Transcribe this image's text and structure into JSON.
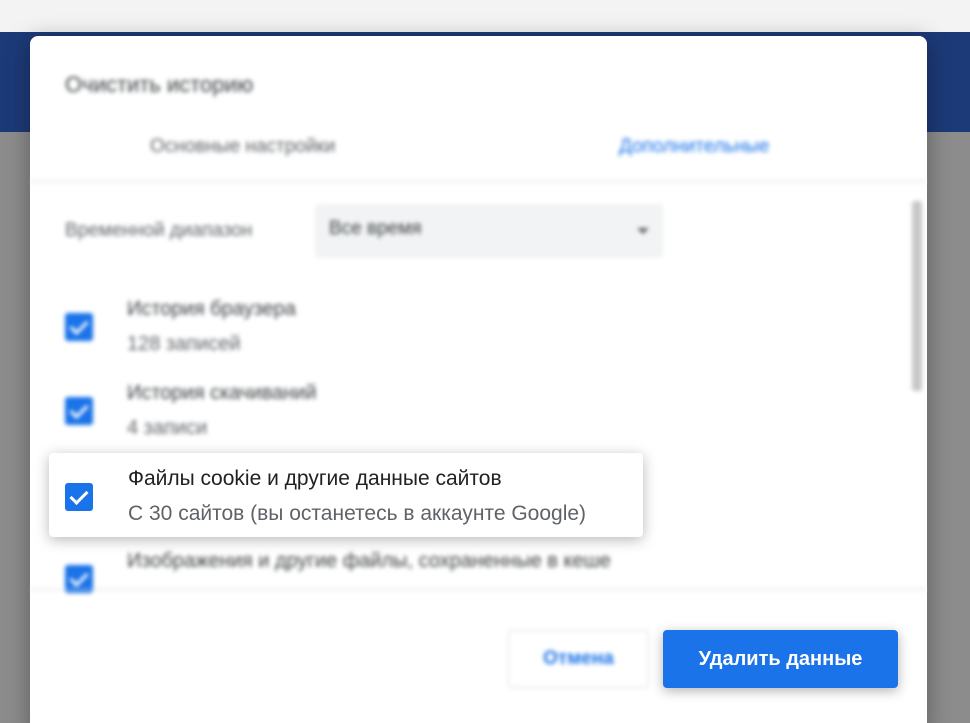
{
  "dialog": {
    "title": "Очистить историю",
    "tabs": [
      {
        "label": "Основные настройки",
        "active": false
      },
      {
        "label": "Дополнительные",
        "active": true
      }
    ],
    "time_range": {
      "label": "Временной диапазон",
      "value": "Все время"
    },
    "items": [
      {
        "title": "История браузера",
        "detail": "128 записей",
        "checked": true
      },
      {
        "title": "История скачиваний",
        "detail": "4 записи",
        "checked": true
      },
      {
        "title": "Файлы cookie и другие данные сайтов",
        "detail": "С 30 сайтов (вы останетесь в аккаунте Google)",
        "checked": true,
        "highlighted": true
      },
      {
        "title": "Изображения и другие файлы, сохраненные в кеше",
        "detail": "",
        "checked": true
      }
    ],
    "buttons": {
      "cancel": "Отмена",
      "delete": "Удалить данные"
    }
  },
  "colors": {
    "accent": "#1a73e8",
    "header": "#1d3a78"
  }
}
